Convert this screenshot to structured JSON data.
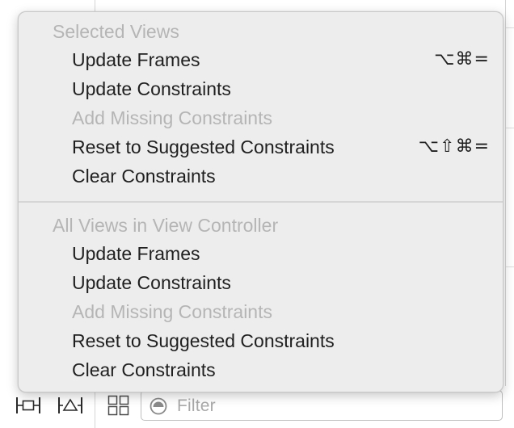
{
  "menu": {
    "sections": [
      {
        "header": "Selected Views",
        "items": [
          {
            "label": "Update Frames",
            "shortcut": "⌥⌘=",
            "enabled": true
          },
          {
            "label": "Update Constraints",
            "shortcut": "",
            "enabled": true
          },
          {
            "label": "Add Missing Constraints",
            "shortcut": "",
            "enabled": false
          },
          {
            "label": "Reset to Suggested Constraints",
            "shortcut": "⌥⇧⌘=",
            "enabled": true
          },
          {
            "label": "Clear Constraints",
            "shortcut": "",
            "enabled": true
          }
        ]
      },
      {
        "header": "All Views in View Controller",
        "items": [
          {
            "label": "Update Frames",
            "shortcut": "",
            "enabled": true
          },
          {
            "label": "Update Constraints",
            "shortcut": "",
            "enabled": true
          },
          {
            "label": "Add Missing Constraints",
            "shortcut": "",
            "enabled": false
          },
          {
            "label": "Reset to Suggested Constraints",
            "shortcut": "",
            "enabled": true
          },
          {
            "label": "Clear Constraints",
            "shortcut": "",
            "enabled": true
          }
        ]
      }
    ]
  },
  "bottom_bar": {
    "filter_placeholder": "Filter",
    "icons": [
      "align-icon",
      "pin-icon",
      "grid-icon",
      "filter-icon"
    ]
  },
  "colors": {
    "menu_background": "#ededed",
    "text_enabled": "#1f1f1f",
    "text_disabled": "#b5b5b5"
  }
}
